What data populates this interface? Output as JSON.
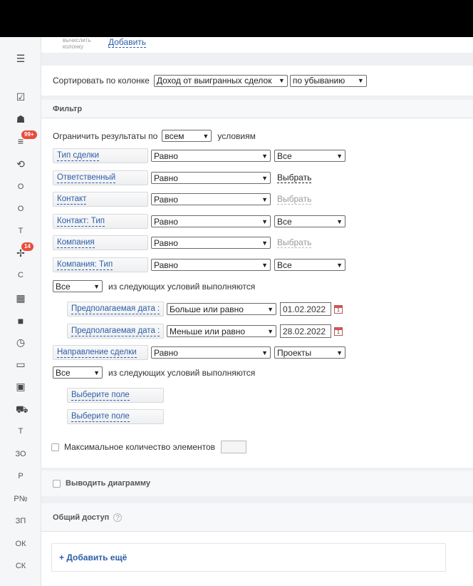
{
  "sidebar": {
    "items": [
      {
        "icon": "menu-icon",
        "label": ""
      },
      {
        "icon": "checkbox-icon",
        "label": ""
      },
      {
        "icon": "android-icon",
        "label": ""
      },
      {
        "icon": "filter-icon",
        "label": "",
        "badge": "99+"
      },
      {
        "icon": "refresh-icon",
        "label": ""
      },
      {
        "icon": "",
        "label": "О"
      },
      {
        "icon": "",
        "label": "О"
      },
      {
        "icon": "",
        "label": "Т"
      },
      {
        "icon": "puzzle-icon",
        "label": "",
        "badge": "14"
      },
      {
        "icon": "",
        "label": "С"
      },
      {
        "icon": "grid-icon",
        "label": ""
      },
      {
        "icon": "video-icon",
        "label": ""
      },
      {
        "icon": "clock-icon",
        "label": ""
      },
      {
        "icon": "window-icon",
        "label": ""
      },
      {
        "icon": "contact-card-icon",
        "label": ""
      },
      {
        "icon": "cart-icon",
        "label": ""
      },
      {
        "icon": "",
        "label": "Т"
      },
      {
        "icon": "",
        "label": "ЗО"
      },
      {
        "icon": "",
        "label": "Р"
      },
      {
        "icon": "",
        "label": "Р№"
      },
      {
        "icon": "",
        "label": "ЗП"
      },
      {
        "icon": "",
        "label": "ОК"
      },
      {
        "icon": "",
        "label": "СК"
      }
    ]
  },
  "addcol": {
    "small_text": "вычислить колонку",
    "add_link": "Добавить"
  },
  "sort": {
    "label": "Сортировать по колонке",
    "column": "Доход от выигранных сделок",
    "order": "по убыванию"
  },
  "filter": {
    "title": "Фильтр",
    "limit_prefix": "Ограничить результаты по",
    "limit_value": "всем",
    "limit_suffix": "условиям",
    "rows": [
      {
        "field": "Тип сделки",
        "op": "Равно",
        "value_type": "select",
        "value": "Все"
      },
      {
        "field": "Ответственный",
        "op": "Равно",
        "value_type": "pick",
        "value": "Выбрать"
      },
      {
        "field": "Контакт",
        "op": "Равно",
        "value_type": "pick-disabled",
        "value": "Выбрать"
      },
      {
        "field": "Контакт: Тип",
        "op": "Равно",
        "value_type": "select",
        "value": "Все"
      },
      {
        "field": "Компания",
        "op": "Равно",
        "value_type": "pick-disabled",
        "value": "Выбрать"
      },
      {
        "field": "Компания: Тип",
        "op": "Равно",
        "value_type": "select",
        "value": "Все"
      }
    ],
    "group1": {
      "mode": "Все",
      "text": "из следующих условий выполняются",
      "rows": [
        {
          "field": "Предполагаемая дата :",
          "op": "Больше или равно",
          "date": "01.02.2022"
        },
        {
          "field": "Предполагаемая дата :",
          "op": "Меньше или равно",
          "date": "28.02.2022"
        }
      ]
    },
    "direction": {
      "field": "Направление сделки",
      "op": "Равно",
      "value": "Проекты"
    },
    "group2": {
      "mode": "Все",
      "text": "из следующих условий выполняются",
      "choose1": "Выберите поле",
      "choose2": "Выберите поле"
    },
    "max_label": "Максимальное количество элементов"
  },
  "diagram": {
    "label": "Выводить диаграмму"
  },
  "share": {
    "title": "Общий доступ",
    "help": "?",
    "add": "+ Добавить ещё"
  }
}
